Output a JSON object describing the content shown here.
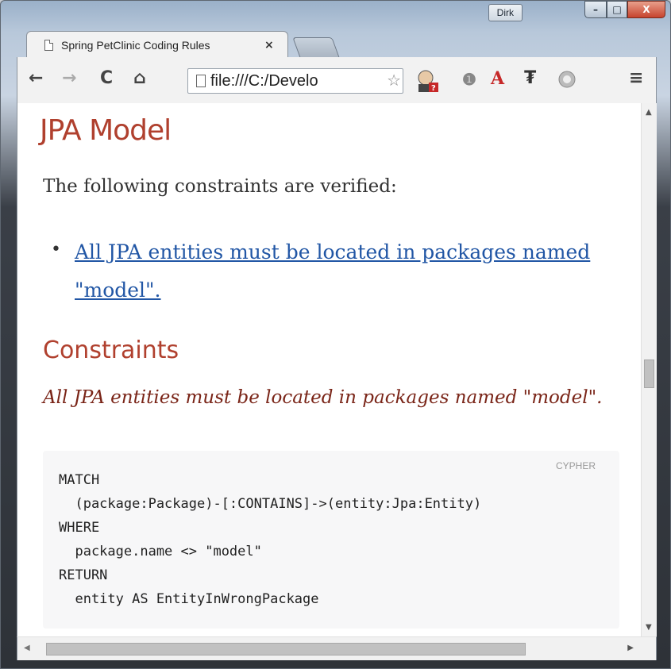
{
  "window": {
    "user_label": "Dirk",
    "minimize_label": "–",
    "maximize_label": "□",
    "close_label": "X"
  },
  "tab": {
    "title": "Spring PetClinic Coding Rules",
    "close_label": "×"
  },
  "toolbar": {
    "back_label": "←",
    "forward_label": "→",
    "reload_label": "C",
    "home_label": "⌂",
    "url": "file:///C:/Develo",
    "star_label": "☆",
    "menu_label": "≡"
  },
  "content": {
    "heading": "JPA Model",
    "intro": "The following constraints are verified:",
    "bullet": "•",
    "rule_link": "All JPA entities must be located in packages named \"model\".",
    "constraints_heading": "Constraints",
    "constraint_description": "All JPA entities must be located in packages named \"model\".",
    "code_language": "CYPHER",
    "code": "MATCH\n  (package:Package)-[:CONTAINS]->(entity:Jpa:Entity)\nWHERE\n  package.name <> \"model\"\nRETURN\n  entity AS EntityInWrongPackage"
  },
  "colors": {
    "heading": "#b0402e",
    "link": "#2156a5",
    "description": "#7a2518"
  }
}
